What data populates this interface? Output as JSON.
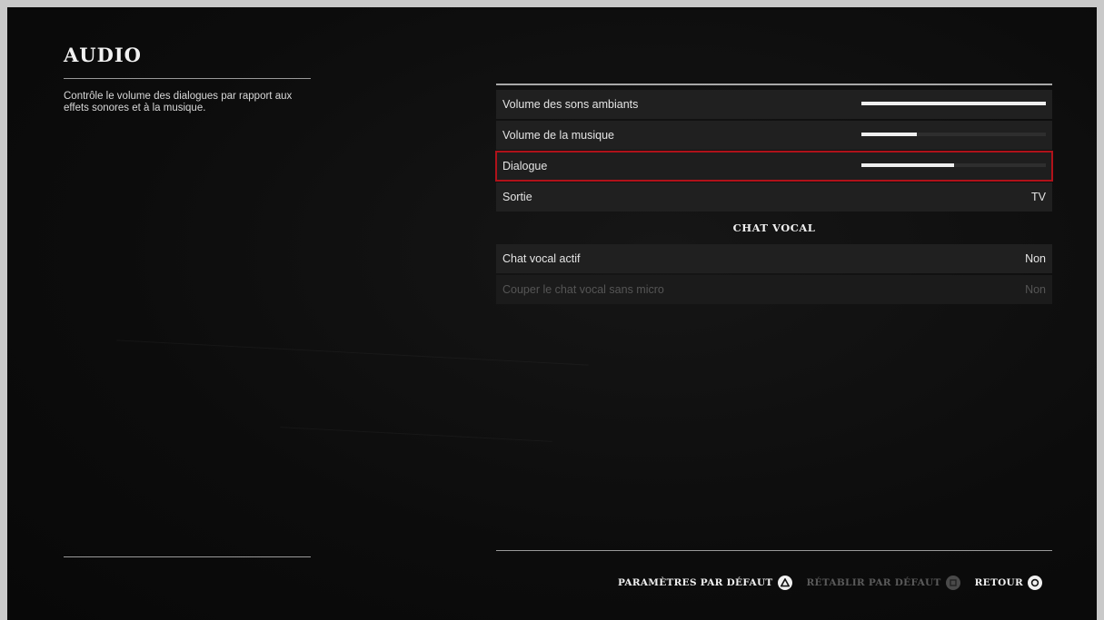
{
  "page": {
    "title": "AUDIO",
    "description": "Contrôle le volume des dialogues par rapport aux effets sonores et à la musique."
  },
  "settings": {
    "rows": [
      {
        "label": "Volume des sons ambiants",
        "type": "slider",
        "level": 1.0
      },
      {
        "label": "Volume de la musique",
        "type": "slider",
        "level": 0.3
      },
      {
        "label": "Dialogue",
        "type": "slider",
        "level": 0.5,
        "selected": true
      },
      {
        "label": "Sortie",
        "type": "value",
        "value": "TV"
      }
    ],
    "section_header": "CHAT VOCAL",
    "chat_rows": [
      {
        "label": "Chat vocal actif",
        "value": "Non",
        "disabled": false
      },
      {
        "label": "Couper le chat vocal sans micro",
        "value": "Non",
        "disabled": true
      }
    ]
  },
  "footer": {
    "default_params_label": "PARAMÈTRES PAR DÉFAUT",
    "restore_default_label": "RÉTABLIR PAR DÉFAUT",
    "back_label": "RETOUR"
  },
  "colors": {
    "selection_border": "#b0121a",
    "slider_fill": "#efefef",
    "row_background": "#202020"
  },
  "icons": {
    "default_params": "triangle-button-icon",
    "restore_default": "square-button-icon",
    "back": "circle-button-icon"
  }
}
